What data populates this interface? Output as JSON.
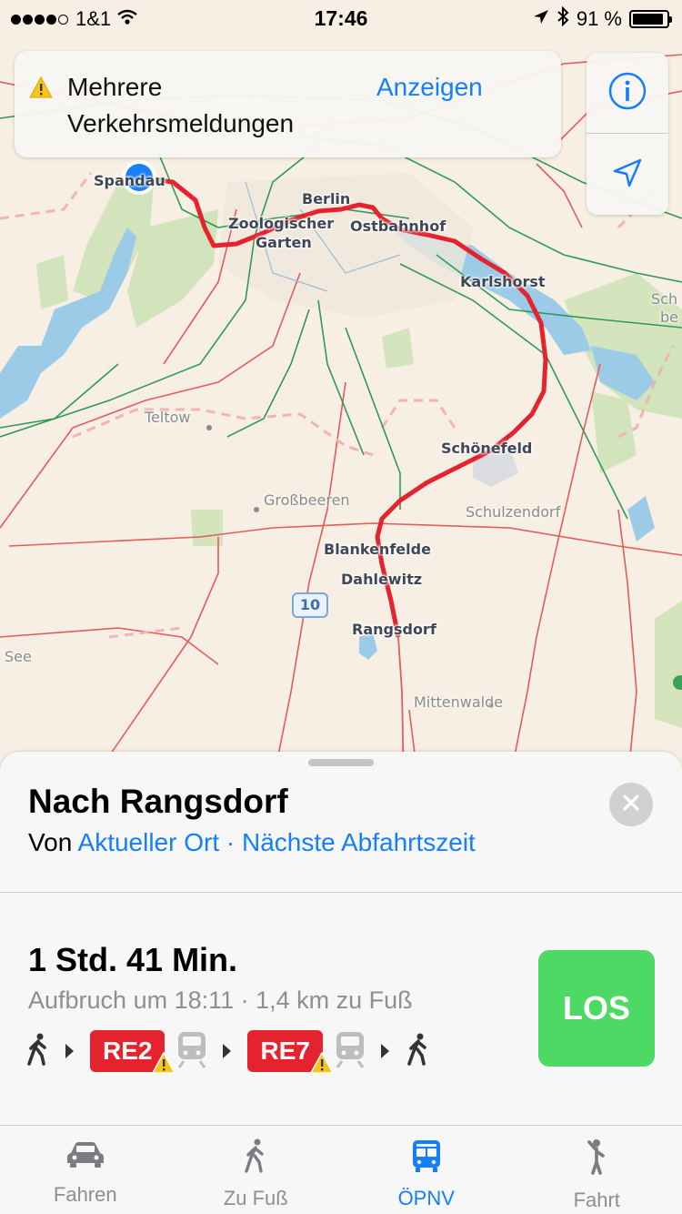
{
  "status_bar": {
    "carrier": "1&1",
    "time": "17:46",
    "battery": "91 %",
    "battery_level": 0.91
  },
  "traffic_banner": {
    "line1": "Mehrere",
    "line2": "Verkehrsmeldungen",
    "action": "Anzeigen"
  },
  "map": {
    "labels": {
      "spandau": "Spandau",
      "berlin": "Berlin",
      "zoo1": "Zoologischer",
      "zoo2": "Garten",
      "ostbahnhof": "Ostbahnhof",
      "karlshorst": "Karlshorst",
      "schoenefeld": "Schönefeld",
      "teltow": "Teltow",
      "grossbeeren": "Großbeeren",
      "schulzendorf": "Schulzendorf",
      "blankenfelde": "Blankenfelde",
      "dahlewitz": "Dahlewitz",
      "rangsdorf": "Rangsdorf",
      "mittenwalde": "Mittenwalde",
      "see": "See",
      "sch1": "Sch",
      "sch2": "be",
      "highway": "10"
    }
  },
  "sheet": {
    "title": "Nach Rangsdorf",
    "from_prefix": "Von",
    "from_location": "Aktueller Ort",
    "separator": "·",
    "departure_option": "Nächste Abfahrtszeit",
    "duration": "1 Std. 41 Min.",
    "depart_info": "Aufbruch um 18:11 · 1,4 km zu Fuß",
    "lines": [
      "RE2",
      "RE7"
    ],
    "go_label": "LOS",
    "colors": {
      "line_red": "#e5232f",
      "go_green": "#4cd964",
      "accent_blue": "#147efb"
    }
  },
  "tabs": [
    {
      "label": "Fahren",
      "icon": "car-icon",
      "active": false
    },
    {
      "label": "Zu Fuß",
      "icon": "walk-icon",
      "active": false
    },
    {
      "label": "ÖPNV",
      "icon": "transit-icon",
      "active": true
    },
    {
      "label": "Fahrt",
      "icon": "ride-icon",
      "active": false
    }
  ]
}
